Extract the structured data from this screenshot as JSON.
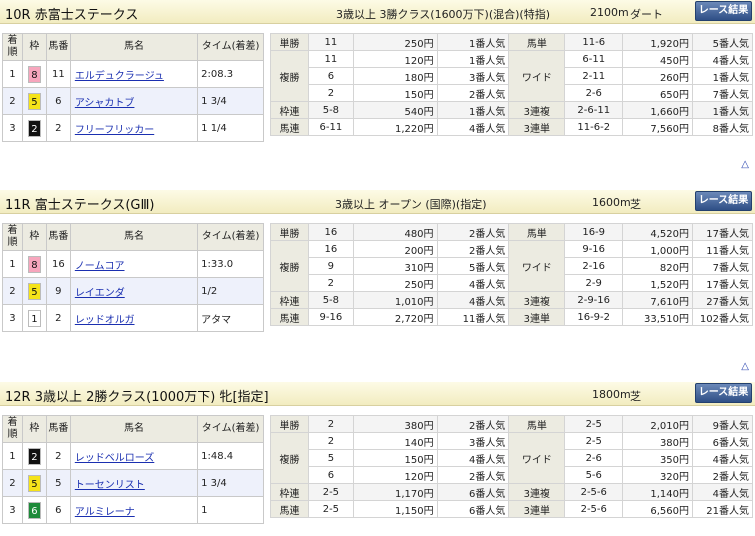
{
  "races": [
    {
      "title": "10R 赤富士ステークス",
      "class": "3歳以上 3勝クラス(1600万下)(混合)(特指)",
      "distance": "2100m",
      "track": "ダート",
      "button": "レース結果",
      "headers": [
        "着順",
        "枠",
        "馬番",
        "馬名",
        "タイム(着差)"
      ],
      "results": [
        {
          "pos": "1",
          "waku": "8",
          "num": "11",
          "name": "エルデュクラージュ",
          "time": "2:08.3"
        },
        {
          "pos": "2",
          "waku": "5",
          "num": "6",
          "name": "アシャカトブ",
          "time": "1 3/4"
        },
        {
          "pos": "3",
          "waku": "2",
          "num": "2",
          "name": "フリーフリッカー",
          "time": "1 1/4"
        }
      ],
      "payout": {
        "tansho": {
          "label": "単勝",
          "combo": "11",
          "yen": "250円",
          "pop": "1番人気"
        },
        "fukusho": {
          "label": "複勝",
          "rows": [
            {
              "combo": "11",
              "yen": "120円",
              "pop": "1番人気"
            },
            {
              "combo": "6",
              "yen": "180円",
              "pop": "3番人気"
            },
            {
              "combo": "2",
              "yen": "150円",
              "pop": "2番人気"
            }
          ]
        },
        "wakuren": {
          "label": "枠連",
          "combo": "5-8",
          "yen": "540円",
          "pop": "1番人気"
        },
        "umaren": {
          "label": "馬連",
          "combo": "6-11",
          "yen": "1,220円",
          "pop": "4番人気"
        },
        "umatan": {
          "label": "馬単",
          "combo": "11-6",
          "yen": "1,920円",
          "pop": "5番人気"
        },
        "wide": {
          "label": "ワイド",
          "rows": [
            {
              "combo": "6-11",
              "yen": "450円",
              "pop": "4番人気"
            },
            {
              "combo": "2-11",
              "yen": "260円",
              "pop": "1番人気"
            },
            {
              "combo": "2-6",
              "yen": "650円",
              "pop": "7番人気"
            }
          ]
        },
        "sanrenpuku": {
          "label": "3連複",
          "combo": "2-6-11",
          "yen": "1,660円",
          "pop": "1番人気"
        },
        "sanrentan": {
          "label": "3連単",
          "combo": "11-6-2",
          "yen": "7,560円",
          "pop": "8番人気"
        }
      }
    },
    {
      "title": "11R 富士ステークス(GⅢ)",
      "class": "3歳以上 オープン (国際)(指定)",
      "distance": "1600m",
      "track": "芝",
      "button": "レース結果",
      "headers": [
        "着順",
        "枠",
        "馬番",
        "馬名",
        "タイム(着差)"
      ],
      "results": [
        {
          "pos": "1",
          "waku": "8",
          "num": "16",
          "name": "ノームコア",
          "time": "1:33.0"
        },
        {
          "pos": "2",
          "waku": "5",
          "num": "9",
          "name": "レイエンダ",
          "time": "1/2"
        },
        {
          "pos": "3",
          "waku": "1",
          "num": "2",
          "name": "レッドオルガ",
          "time": "アタマ"
        }
      ],
      "payout": {
        "tansho": {
          "label": "単勝",
          "combo": "16",
          "yen": "480円",
          "pop": "2番人気"
        },
        "fukusho": {
          "label": "複勝",
          "rows": [
            {
              "combo": "16",
              "yen": "200円",
              "pop": "2番人気"
            },
            {
              "combo": "9",
              "yen": "310円",
              "pop": "5番人気"
            },
            {
              "combo": "2",
              "yen": "250円",
              "pop": "4番人気"
            }
          ]
        },
        "wakuren": {
          "label": "枠連",
          "combo": "5-8",
          "yen": "1,010円",
          "pop": "4番人気"
        },
        "umaren": {
          "label": "馬連",
          "combo": "9-16",
          "yen": "2,720円",
          "pop": "11番人気"
        },
        "umatan": {
          "label": "馬単",
          "combo": "16-9",
          "yen": "4,520円",
          "pop": "17番人気"
        },
        "wide": {
          "label": "ワイド",
          "rows": [
            {
              "combo": "9-16",
              "yen": "1,000円",
              "pop": "11番人気"
            },
            {
              "combo": "2-16",
              "yen": "820円",
              "pop": "7番人気"
            },
            {
              "combo": "2-9",
              "yen": "1,520円",
              "pop": "17番人気"
            }
          ]
        },
        "sanrenpuku": {
          "label": "3連複",
          "combo": "2-9-16",
          "yen": "7,610円",
          "pop": "27番人気"
        },
        "sanrentan": {
          "label": "3連単",
          "combo": "16-9-2",
          "yen": "33,510円",
          "pop": "102番人気"
        }
      }
    },
    {
      "title": "12R 3歳以上 2勝クラス(1000万下) 牝[指定]",
      "class": "",
      "distance": "1800m",
      "track": "芝",
      "button": "レース結果",
      "headers": [
        "着順",
        "枠",
        "馬番",
        "馬名",
        "タイム(着差)"
      ],
      "results": [
        {
          "pos": "1",
          "waku": "2",
          "num": "2",
          "name": "レッドベルローズ",
          "time": "1:48.4"
        },
        {
          "pos": "2",
          "waku": "5",
          "num": "5",
          "name": "トーセンリスト",
          "time": "1 3/4"
        },
        {
          "pos": "3",
          "waku": "6",
          "num": "6",
          "name": "アルミレーナ",
          "time": "1"
        }
      ],
      "payout": {
        "tansho": {
          "label": "単勝",
          "combo": "2",
          "yen": "380円",
          "pop": "2番人気"
        },
        "fukusho": {
          "label": "複勝",
          "rows": [
            {
              "combo": "2",
              "yen": "140円",
              "pop": "3番人気"
            },
            {
              "combo": "5",
              "yen": "150円",
              "pop": "4番人気"
            },
            {
              "combo": "6",
              "yen": "120円",
              "pop": "2番人気"
            }
          ]
        },
        "wakuren": {
          "label": "枠連",
          "combo": "2-5",
          "yen": "1,170円",
          "pop": "6番人気"
        },
        "umaren": {
          "label": "馬連",
          "combo": "2-5",
          "yen": "1,150円",
          "pop": "6番人気"
        },
        "umatan": {
          "label": "馬単",
          "combo": "2-5",
          "yen": "2,010円",
          "pop": "9番人気"
        },
        "wide": {
          "label": "ワイド",
          "rows": [
            {
              "combo": "2-5",
              "yen": "380円",
              "pop": "6番人気"
            },
            {
              "combo": "2-6",
              "yen": "350円",
              "pop": "4番人気"
            },
            {
              "combo": "5-6",
              "yen": "320円",
              "pop": "2番人気"
            }
          ]
        },
        "sanrenpuku": {
          "label": "3連複",
          "combo": "2-5-6",
          "yen": "1,140円",
          "pop": "4番人気"
        },
        "sanrentan": {
          "label": "3連単",
          "combo": "2-5-6",
          "yen": "6,560円",
          "pop": "21番人気"
        }
      }
    }
  ],
  "top_link": "△",
  "waku_colors": {
    "1": "#ffffff",
    "2": "#111111",
    "3": "#e0302a",
    "4": "#2c56c6",
    "5": "#f5e31a",
    "6": "#1e8a3a",
    "7": "#f08a24",
    "8": "#f7a6bd"
  }
}
